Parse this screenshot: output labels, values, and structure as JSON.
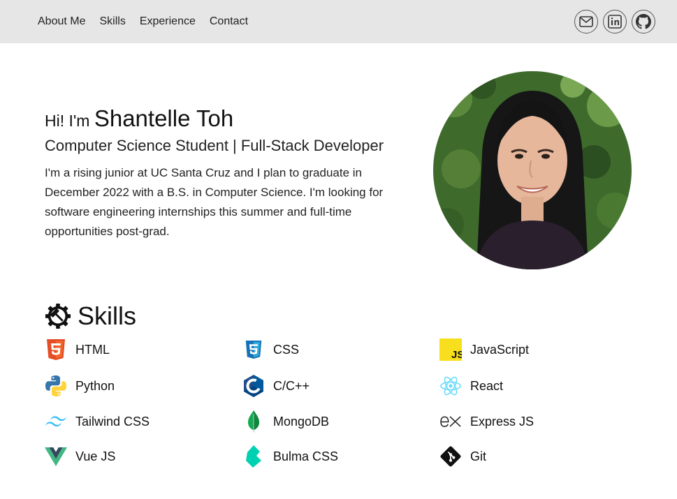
{
  "nav": {
    "links": [
      "About Me",
      "Skills",
      "Experience",
      "Contact"
    ],
    "social": [
      "mail-icon",
      "linkedin-icon",
      "github-icon"
    ]
  },
  "hero": {
    "greeting": "Hi! I'm",
    "name": "Shantelle Toh",
    "subtitle": "Computer Science Student | Full-Stack Developer",
    "bio": "I'm a rising junior at UC Santa Cruz and I plan to graduate in December 2022 with a B.S. in Computer Science. I'm looking for software engineering internships this summer and full-time opportunities post-grad."
  },
  "skills": {
    "title": "Skills",
    "items": [
      {
        "label": "HTML",
        "icon": "html5-icon"
      },
      {
        "label": "CSS",
        "icon": "css3-icon"
      },
      {
        "label": "JavaScript",
        "icon": "javascript-icon"
      },
      {
        "label": "Python",
        "icon": "python-icon"
      },
      {
        "label": "C/C++",
        "icon": "cpp-icon"
      },
      {
        "label": "React",
        "icon": "react-icon"
      },
      {
        "label": "Tailwind CSS",
        "icon": "tailwind-icon"
      },
      {
        "label": "MongoDB",
        "icon": "mongodb-icon"
      },
      {
        "label": "Express JS",
        "icon": "express-icon"
      },
      {
        "label": "Vue JS",
        "icon": "vue-icon"
      },
      {
        "label": "Bulma CSS",
        "icon": "bulma-icon"
      },
      {
        "label": "Git",
        "icon": "git-icon"
      }
    ]
  },
  "colors": {
    "navbar_bg": "#e6e6e6",
    "html": "#e44d26",
    "css": "#1572b6",
    "javascript": "#f7df1e",
    "python_blue": "#3776ab",
    "python_yellow": "#ffd43b",
    "react": "#61dafb",
    "tailwind": "#38bdf8",
    "mongodb": "#47a248",
    "vue_green": "#41b883",
    "vue_dark": "#35495e",
    "bulma": "#00d1b2"
  }
}
